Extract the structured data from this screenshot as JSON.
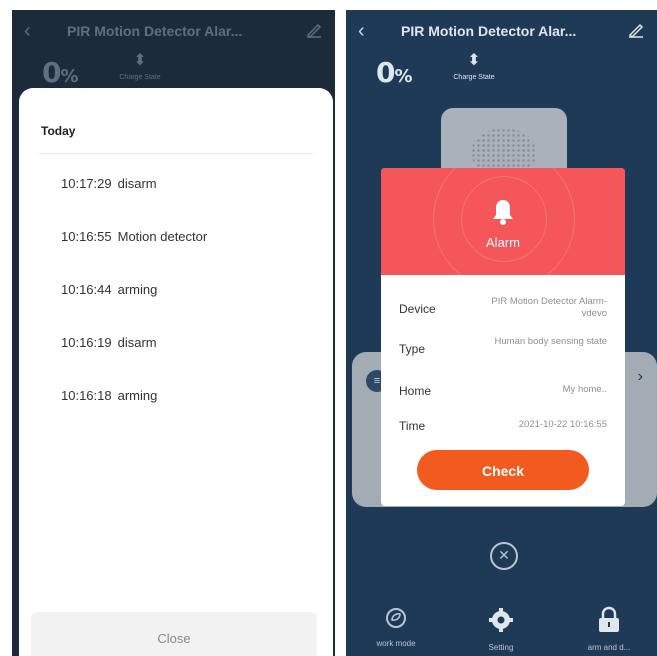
{
  "left_screen": {
    "header": {
      "title": "PIR Motion Detector Alar..."
    },
    "battery": {
      "value": "0",
      "unit": "%"
    },
    "charge_state": "Charge State",
    "history": {
      "group_label": "Today",
      "entries": [
        {
          "time": "10:17:29",
          "event": "disarm"
        },
        {
          "time": "10:16:55",
          "event": "Motion detector"
        },
        {
          "time": "10:16:44",
          "event": "arming"
        },
        {
          "time": "10:16:19",
          "event": "disarm"
        },
        {
          "time": "10:16:18",
          "event": "arming"
        }
      ],
      "close_label": "Close"
    }
  },
  "right_screen": {
    "header": {
      "title": "PIR Motion Detector Alar..."
    },
    "battery": {
      "value": "0",
      "unit": "%"
    },
    "charge_state": "Charge State",
    "alarm": {
      "title": "Alarm",
      "rows": [
        {
          "key": "Device",
          "value": "PIR Motion Detector Alarm-vdevo"
        },
        {
          "key": "Type",
          "value": "Human body sensing state"
        },
        {
          "key": "Home",
          "value": "My home.."
        },
        {
          "key": "Time",
          "value": "2021-10-22 10:16:55"
        }
      ],
      "check_label": "Check",
      "dismiss_icon": "close-circle-icon"
    },
    "bottom_bar": [
      {
        "label": "work mode",
        "icon": "shield-icon"
      },
      {
        "label": "Setting",
        "icon": "gear-icon"
      },
      {
        "label": "arm and d...",
        "icon": "lock-icon"
      }
    ]
  },
  "colors": {
    "alarm_header": "#f45659",
    "check_button": "#f35a1f",
    "right_background": "#1e3a57",
    "left_background": "#1c2b39"
  }
}
